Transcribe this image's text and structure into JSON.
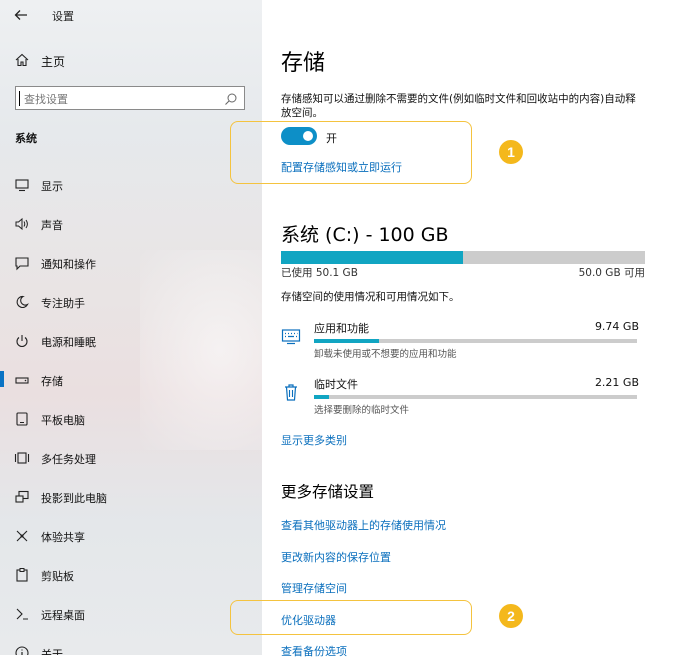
{
  "window": {
    "title": "设置",
    "back_icon": "back-arrow-icon"
  },
  "sidebar": {
    "home_label": "主页",
    "search_placeholder": "查找设置",
    "section_label": "系统",
    "items": [
      {
        "label": "显示",
        "icon": "monitor-icon"
      },
      {
        "label": "声音",
        "icon": "speaker-icon"
      },
      {
        "label": "通知和操作",
        "icon": "notification-icon"
      },
      {
        "label": "专注助手",
        "icon": "moon-icon"
      },
      {
        "label": "电源和睡眠",
        "icon": "power-icon"
      },
      {
        "label": "存储",
        "icon": "storage-icon",
        "active": true
      },
      {
        "label": "平板电脑",
        "icon": "tablet-icon"
      },
      {
        "label": "多任务处理",
        "icon": "multitask-icon"
      },
      {
        "label": "投影到此电脑",
        "icon": "project-icon"
      },
      {
        "label": "体验共享",
        "icon": "share-icon"
      },
      {
        "label": "剪贴板",
        "icon": "clipboard-icon"
      },
      {
        "label": "远程桌面",
        "icon": "remote-icon"
      },
      {
        "label": "关于",
        "icon": "info-icon"
      }
    ]
  },
  "main": {
    "title": "存储",
    "description": "存储感知可以通过删除不需要的文件(例如临时文件和回收站中的内容)自动释放空间。",
    "toggle": {
      "state": "开",
      "on": true
    },
    "configure_link": "配置存储感知或立即运行",
    "drive": {
      "title": "系统 (C:) - 100 GB",
      "used_label": "已使用 50.1 GB",
      "free_label": "50.0 GB 可用",
      "used_fraction": 0.501,
      "note": "存储空间的使用情况和可用情况如下。"
    },
    "categories": [
      {
        "name": "应用和功能",
        "size": "9.74 GB",
        "sub": "卸载未使用或不想要的应用和功能",
        "fraction": 0.2,
        "icon": "keyboard-icon"
      },
      {
        "name": "临时文件",
        "size": "2.21 GB",
        "sub": "选择要删除的临时文件",
        "fraction": 0.045,
        "icon": "trash-icon"
      }
    ],
    "show_more_link": "显示更多类别",
    "more_settings_title": "更多存储设置",
    "more_links": [
      "查看其他驱动器上的存储使用情况",
      "更改新内容的保存位置",
      "管理存储空间",
      "优化驱动器",
      "查看备份选项"
    ],
    "badges": [
      "1",
      "2"
    ]
  },
  "colors": {
    "accent": "#0a6fbd",
    "toggle_on": "#0d8fc7",
    "bar_fill": "#11a5c2",
    "highlight": "#f4c33f",
    "badge": "#f4b81c"
  }
}
